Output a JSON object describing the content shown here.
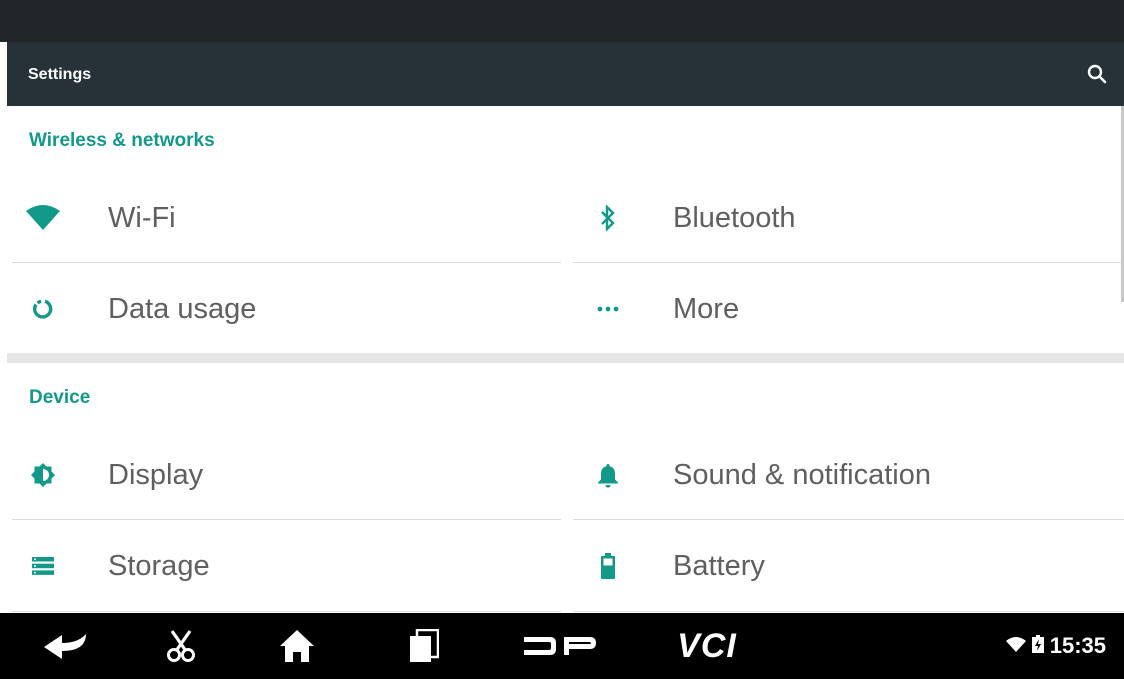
{
  "app": {
    "title": "Settings"
  },
  "sections": [
    {
      "header": "Wireless & networks",
      "items": [
        {
          "label": "Wi-Fi",
          "icon": "wifi-icon"
        },
        {
          "label": "Bluetooth",
          "icon": "bluetooth-icon"
        },
        {
          "label": "Data usage",
          "icon": "data-usage-icon"
        },
        {
          "label": "More",
          "icon": "more-dots-icon"
        }
      ]
    },
    {
      "header": "Device",
      "items": [
        {
          "label": "Display",
          "icon": "display-brightness-icon"
        },
        {
          "label": "Sound & notification",
          "icon": "bell-icon"
        },
        {
          "label": "Storage",
          "icon": "storage-icon"
        },
        {
          "label": "Battery",
          "icon": "battery-icon"
        }
      ]
    }
  ],
  "navbar": {
    "buttons": [
      "back-icon",
      "scissors-icon",
      "home-icon",
      "recent-apps-icon",
      "dp-logo-icon",
      "vci-logo-icon"
    ],
    "vci_text": "VCI",
    "clock": "15:35"
  },
  "colors": {
    "accent": "#12998a",
    "actionbar": "#263238",
    "text": "#5f5f5f"
  }
}
